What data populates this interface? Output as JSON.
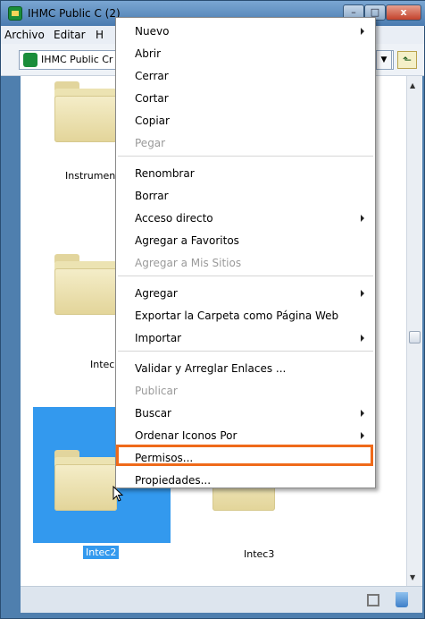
{
  "window": {
    "title": "IHMC Public C",
    "title_suffix": "(2)",
    "min_label": "–",
    "max_label": "□",
    "close_label": "x"
  },
  "menubar": {
    "items": [
      "Archivo",
      "Editar",
      "H"
    ]
  },
  "toolbar": {
    "path_text": "IHMC Public Cr"
  },
  "folders": [
    {
      "label": "Instrumen"
    },
    {
      "label": "Intec"
    },
    {
      "label": "Intec2"
    },
    {
      "label": "Intec3"
    }
  ],
  "context_menu": {
    "items": [
      {
        "label": "Nuevo",
        "submenu": true,
        "enabled": true
      },
      {
        "label": "Abrir",
        "submenu": false,
        "enabled": true
      },
      {
        "label": "Cerrar",
        "submenu": false,
        "enabled": true
      },
      {
        "label": "Cortar",
        "submenu": false,
        "enabled": true
      },
      {
        "label": "Copiar",
        "submenu": false,
        "enabled": true
      },
      {
        "label": "Pegar",
        "submenu": false,
        "enabled": false
      },
      {
        "label": "Renombrar",
        "submenu": false,
        "enabled": true
      },
      {
        "label": "Borrar",
        "submenu": false,
        "enabled": true
      },
      {
        "label": "Acceso directo",
        "submenu": true,
        "enabled": true
      },
      {
        "label": "Agregar a Favoritos",
        "submenu": false,
        "enabled": true
      },
      {
        "label": "Agregar a Mis Sitios",
        "submenu": false,
        "enabled": false
      },
      {
        "label": "Agregar",
        "submenu": true,
        "enabled": true
      },
      {
        "label": "Exportar la Carpeta como Página Web",
        "submenu": false,
        "enabled": true
      },
      {
        "label": "Importar",
        "submenu": true,
        "enabled": true
      },
      {
        "label": "Validar y Arreglar Enlaces ...",
        "submenu": false,
        "enabled": true
      },
      {
        "label": "Publicar",
        "submenu": false,
        "enabled": false
      },
      {
        "label": "Buscar",
        "submenu": true,
        "enabled": true
      },
      {
        "label": "Ordenar Iconos Por",
        "submenu": true,
        "enabled": true
      },
      {
        "label": "Permisos...",
        "submenu": false,
        "enabled": true,
        "highlighted": true
      },
      {
        "label": "Propiedades...",
        "submenu": false,
        "enabled": true
      }
    ]
  },
  "colors": {
    "selection": "#3399ee",
    "highlight_outline": "#ef6a1a",
    "disabled_text": "#9a9a9a"
  }
}
